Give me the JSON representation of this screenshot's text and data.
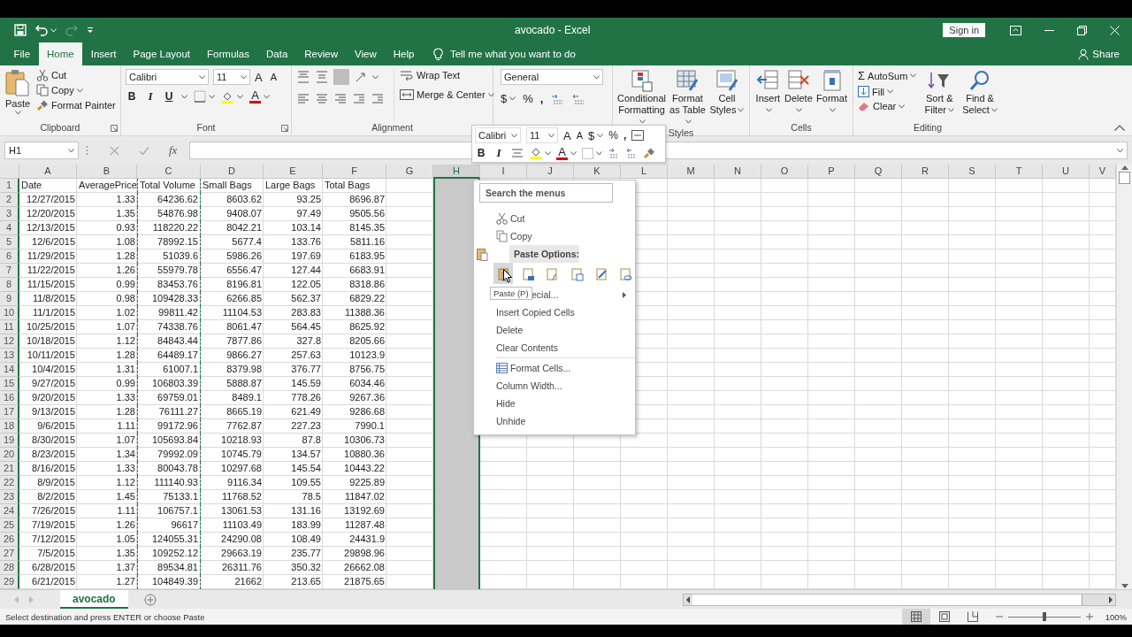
{
  "window": {
    "title": "avocado  -  Excel",
    "sign_in": "Sign in"
  },
  "tabs": [
    {
      "label": "File",
      "selected": false
    },
    {
      "label": "Home",
      "selected": true
    },
    {
      "label": "Insert",
      "selected": false
    },
    {
      "label": "Page Layout",
      "selected": false
    },
    {
      "label": "Formulas",
      "selected": false
    },
    {
      "label": "Data",
      "selected": false
    },
    {
      "label": "Review",
      "selected": false
    },
    {
      "label": "View",
      "selected": false
    },
    {
      "label": "Help",
      "selected": false
    }
  ],
  "tell_me": "Tell me what you want to do",
  "share": "Share",
  "ribbon": {
    "clipboard": {
      "label": "Clipboard",
      "paste": "Paste",
      "cut": "Cut",
      "copy": "Copy",
      "format_painter": "Format Painter"
    },
    "font": {
      "label": "Font",
      "font_name": "Calibri",
      "font_size": "11",
      "grow": "A",
      "shrink": "A",
      "bold": "B",
      "italic": "I",
      "underline": "U",
      "font_color": "A"
    },
    "alignment": {
      "label": "Alignment",
      "wrap_text": "Wrap Text",
      "merge_center": "Merge & Center"
    },
    "number": {
      "format": "General",
      "currency": "$",
      "percent": "%",
      "comma": ","
    },
    "styles": {
      "label": "Styles",
      "conditional_formatting": "Conditional Formatting",
      "format_as_table": "Format as Table",
      "cell_styles": "Cell Styles"
    },
    "cells": {
      "label": "Cells",
      "insert": "Insert",
      "delete": "Delete",
      "format": "Format"
    },
    "editing": {
      "label": "Editing",
      "sigma": "Σ",
      "autosum": "AutoSum",
      "fill": "Fill",
      "clear": "Clear",
      "sort_filter": "Sort & Filter",
      "find_select": "Find & Select"
    }
  },
  "formula_bar": {
    "name_box": "H1",
    "fx": "fx"
  },
  "sheet": {
    "columns": [
      {
        "letter": "A",
        "selected": false,
        "marquee": false
      },
      {
        "letter": "B",
        "selected": false,
        "marquee": false
      },
      {
        "letter": "C",
        "selected": false,
        "marquee": true
      },
      {
        "letter": "D",
        "selected": false,
        "marquee": false
      },
      {
        "letter": "E",
        "selected": false,
        "marquee": false
      },
      {
        "letter": "F",
        "selected": false,
        "marquee": false
      },
      {
        "letter": "G",
        "selected": false,
        "marquee": false
      },
      {
        "letter": "H",
        "selected": true,
        "marquee": false
      },
      {
        "letter": "I",
        "selected": false,
        "marquee": false
      },
      {
        "letter": "J",
        "selected": false,
        "marquee": false
      },
      {
        "letter": "K",
        "selected": false,
        "marquee": false
      },
      {
        "letter": "L",
        "selected": false,
        "marquee": false
      },
      {
        "letter": "M",
        "selected": false,
        "marquee": false
      },
      {
        "letter": "N",
        "selected": false,
        "marquee": false
      },
      {
        "letter": "O",
        "selected": false,
        "marquee": false
      },
      {
        "letter": "P",
        "selected": false,
        "marquee": false
      },
      {
        "letter": "Q",
        "selected": false,
        "marquee": false
      },
      {
        "letter": "R",
        "selected": false,
        "marquee": false
      },
      {
        "letter": "S",
        "selected": false,
        "marquee": false
      },
      {
        "letter": "T",
        "selected": false,
        "marquee": false
      },
      {
        "letter": "U",
        "selected": false,
        "marquee": false
      },
      {
        "letter": "V",
        "selected": false,
        "marquee": false
      }
    ],
    "rows": [
      {
        "number": "1",
        "kind": "header",
        "cells": [
          "Date",
          "AveragePrice",
          "Total Volume",
          "Small Bags",
          "Large Bags",
          "Total Bags"
        ]
      },
      {
        "number": "2",
        "kind": "data",
        "cells": [
          "12/27/2015",
          "1.33",
          "64236.62",
          "8603.62",
          "93.25",
          "8696.87"
        ]
      },
      {
        "number": "3",
        "kind": "data",
        "cells": [
          "12/20/2015",
          "1.35",
          "54876.98",
          "9408.07",
          "97.49",
          "9505.56"
        ]
      },
      {
        "number": "4",
        "kind": "data",
        "cells": [
          "12/13/2015",
          "0.93",
          "118220.22",
          "8042.21",
          "103.14",
          "8145.35"
        ]
      },
      {
        "number": "5",
        "kind": "data",
        "cells": [
          "12/6/2015",
          "1.08",
          "78992.15",
          "5677.4",
          "133.76",
          "5811.16"
        ]
      },
      {
        "number": "6",
        "kind": "data",
        "cells": [
          "11/29/2015",
          "1.28",
          "51039.6",
          "5986.26",
          "197.69",
          "6183.95"
        ]
      },
      {
        "number": "7",
        "kind": "data",
        "cells": [
          "11/22/2015",
          "1.26",
          "55979.78",
          "6556.47",
          "127.44",
          "6683.91"
        ]
      },
      {
        "number": "8",
        "kind": "data",
        "cells": [
          "11/15/2015",
          "0.99",
          "83453.76",
          "8196.81",
          "122.05",
          "8318.86"
        ]
      },
      {
        "number": "9",
        "kind": "data",
        "cells": [
          "11/8/2015",
          "0.98",
          "109428.33",
          "6266.85",
          "562.37",
          "6829.22"
        ]
      },
      {
        "number": "10",
        "kind": "data",
        "cells": [
          "11/1/2015",
          "1.02",
          "99811.42",
          "11104.53",
          "283.83",
          "11388.36"
        ]
      },
      {
        "number": "11",
        "kind": "data",
        "cells": [
          "10/25/2015",
          "1.07",
          "74338.76",
          "8061.47",
          "564.45",
          "8625.92"
        ]
      },
      {
        "number": "12",
        "kind": "data",
        "cells": [
          "10/18/2015",
          "1.12",
          "84843.44",
          "7877.86",
          "327.8",
          "8205.66"
        ]
      },
      {
        "number": "13",
        "kind": "data",
        "cells": [
          "10/11/2015",
          "1.28",
          "64489.17",
          "9866.27",
          "257.63",
          "10123.9"
        ]
      },
      {
        "number": "14",
        "kind": "data",
        "cells": [
          "10/4/2015",
          "1.31",
          "61007.1",
          "8379.98",
          "376.77",
          "8756.75"
        ]
      },
      {
        "number": "15",
        "kind": "data",
        "cells": [
          "9/27/2015",
          "0.99",
          "106803.39",
          "5888.87",
          "145.59",
          "6034.46"
        ]
      },
      {
        "number": "16",
        "kind": "data",
        "cells": [
          "9/20/2015",
          "1.33",
          "69759.01",
          "8489.1",
          "778.26",
          "9267.36"
        ]
      },
      {
        "number": "17",
        "kind": "data",
        "cells": [
          "9/13/2015",
          "1.28",
          "76111.27",
          "8665.19",
          "621.49",
          "9286.68"
        ]
      },
      {
        "number": "18",
        "kind": "data",
        "cells": [
          "9/6/2015",
          "1.11",
          "99172.96",
          "7762.87",
          "227.23",
          "7990.1"
        ]
      },
      {
        "number": "19",
        "kind": "data",
        "cells": [
          "8/30/2015",
          "1.07",
          "105693.84",
          "10218.93",
          "87.8",
          "10306.73"
        ]
      },
      {
        "number": "20",
        "kind": "data",
        "cells": [
          "8/23/2015",
          "1.34",
          "79992.09",
          "10745.79",
          "134.57",
          "10880.36"
        ]
      },
      {
        "number": "21",
        "kind": "data",
        "cells": [
          "8/16/2015",
          "1.33",
          "80043.78",
          "10297.68",
          "145.54",
          "10443.22"
        ]
      },
      {
        "number": "22",
        "kind": "data",
        "cells": [
          "8/9/2015",
          "1.12",
          "111140.93",
          "9116.34",
          "109.55",
          "9225.89"
        ]
      },
      {
        "number": "23",
        "kind": "data",
        "cells": [
          "8/2/2015",
          "1.45",
          "75133.1",
          "11768.52",
          "78.5",
          "11847.02"
        ]
      },
      {
        "number": "24",
        "kind": "data",
        "cells": [
          "7/26/2015",
          "1.11",
          "106757.1",
          "13061.53",
          "131.16",
          "13192.69"
        ]
      },
      {
        "number": "25",
        "kind": "data",
        "cells": [
          "7/19/2015",
          "1.26",
          "96617",
          "11103.49",
          "183.99",
          "11287.48"
        ]
      },
      {
        "number": "26",
        "kind": "data",
        "cells": [
          "7/12/2015",
          "1.05",
          "124055.31",
          "24290.08",
          "108.49",
          "24431.9"
        ]
      },
      {
        "number": "27",
        "kind": "data",
        "cells": [
          "7/5/2015",
          "1.35",
          "109252.12",
          "29663.19",
          "235.77",
          "29898.96"
        ]
      },
      {
        "number": "28",
        "kind": "data",
        "cells": [
          "6/28/2015",
          "1.37",
          "89534.81",
          "26311.76",
          "350.32",
          "26662.08"
        ]
      },
      {
        "number": "29",
        "kind": "data",
        "cells": [
          "6/21/2015",
          "1.27",
          "104849.39",
          "21662",
          "213.65",
          "21875.65"
        ]
      }
    ]
  },
  "mini_toolbar": {
    "font_name": "Calibri",
    "font_size": "11",
    "grow": "A",
    "shrink": "A",
    "currency": "$",
    "percent": "%",
    "comma": ",",
    "bold": "B",
    "italic": "I",
    "font_color": "A"
  },
  "context_menu": {
    "search": {
      "placeholder": "Search the menus"
    },
    "items": [
      {
        "kind": "cut",
        "label": "Cut"
      },
      {
        "kind": "copy",
        "label": "Copy"
      },
      {
        "kind": "paste_header",
        "label": "Paste Options:"
      },
      {
        "kind": "paste_buttons",
        "buttons": [
          {
            "selected": true
          },
          {
            "selected": false
          },
          {
            "selected": false
          },
          {
            "selected": false
          },
          {
            "selected": false
          },
          {
            "selected": false
          }
        ]
      },
      {
        "kind": "submenu",
        "label": "ecial..."
      },
      {
        "kind": "plain",
        "label": "Insert Copied Cells"
      },
      {
        "kind": "plain",
        "label": "Delete"
      },
      {
        "kind": "plain",
        "label": "Clear Contents"
      },
      {
        "kind": "format",
        "label": "Format Cells..."
      },
      {
        "kind": "plain",
        "label": "Column Width..."
      },
      {
        "kind": "plain",
        "label": "Hide"
      },
      {
        "kind": "plain",
        "label": "Unhide"
      }
    ]
  },
  "tooltip": "Paste (P)",
  "sheet_tabs": [
    {
      "label": "avocado",
      "selected": true
    }
  ],
  "status_bar": {
    "message": "Select destination and press ENTER or choose Paste",
    "views": [
      {
        "selected": true
      },
      {
        "selected": false
      },
      {
        "selected": false
      }
    ],
    "zoom": {
      "level": 0.5,
      "reading": "100%"
    }
  }
}
